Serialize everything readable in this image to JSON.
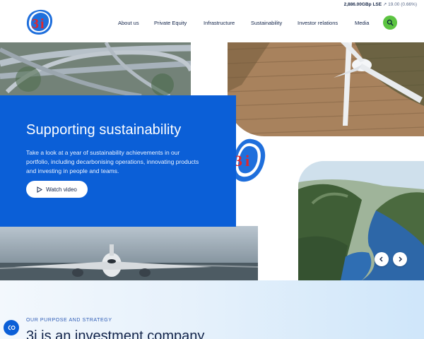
{
  "header": {
    "stock": {
      "price": "2,886.00GBp LSE",
      "change": "↗ 19.00 (0.66%)"
    },
    "logo_alt": "3i",
    "nav": [
      {
        "label": "About us"
      },
      {
        "label": "Private Equity"
      },
      {
        "label": "Infrastructure"
      },
      {
        "label": "Sustainability"
      },
      {
        "label": "Investor relations"
      },
      {
        "label": "Media"
      }
    ],
    "search_icon": "search-icon"
  },
  "hero": {
    "title": "Supporting sustainability",
    "body": "Take a look at a year of sustainability achievements in our portfolio, including decarbonising operations, innovating products and investing in people and teams.",
    "watch_label": "Watch video",
    "prev_icon": "chevron-left-icon",
    "next_icon": "chevron-right-icon"
  },
  "purpose": {
    "eyebrow": "OUR PURPOSE AND STRATEGY",
    "title": "3i is an investment company"
  },
  "cookie": {
    "label": "CO"
  },
  "colors": {
    "brand_blue": "#0b5fd7",
    "accent_green": "#5cc441",
    "logo_red": "#e3262b"
  }
}
